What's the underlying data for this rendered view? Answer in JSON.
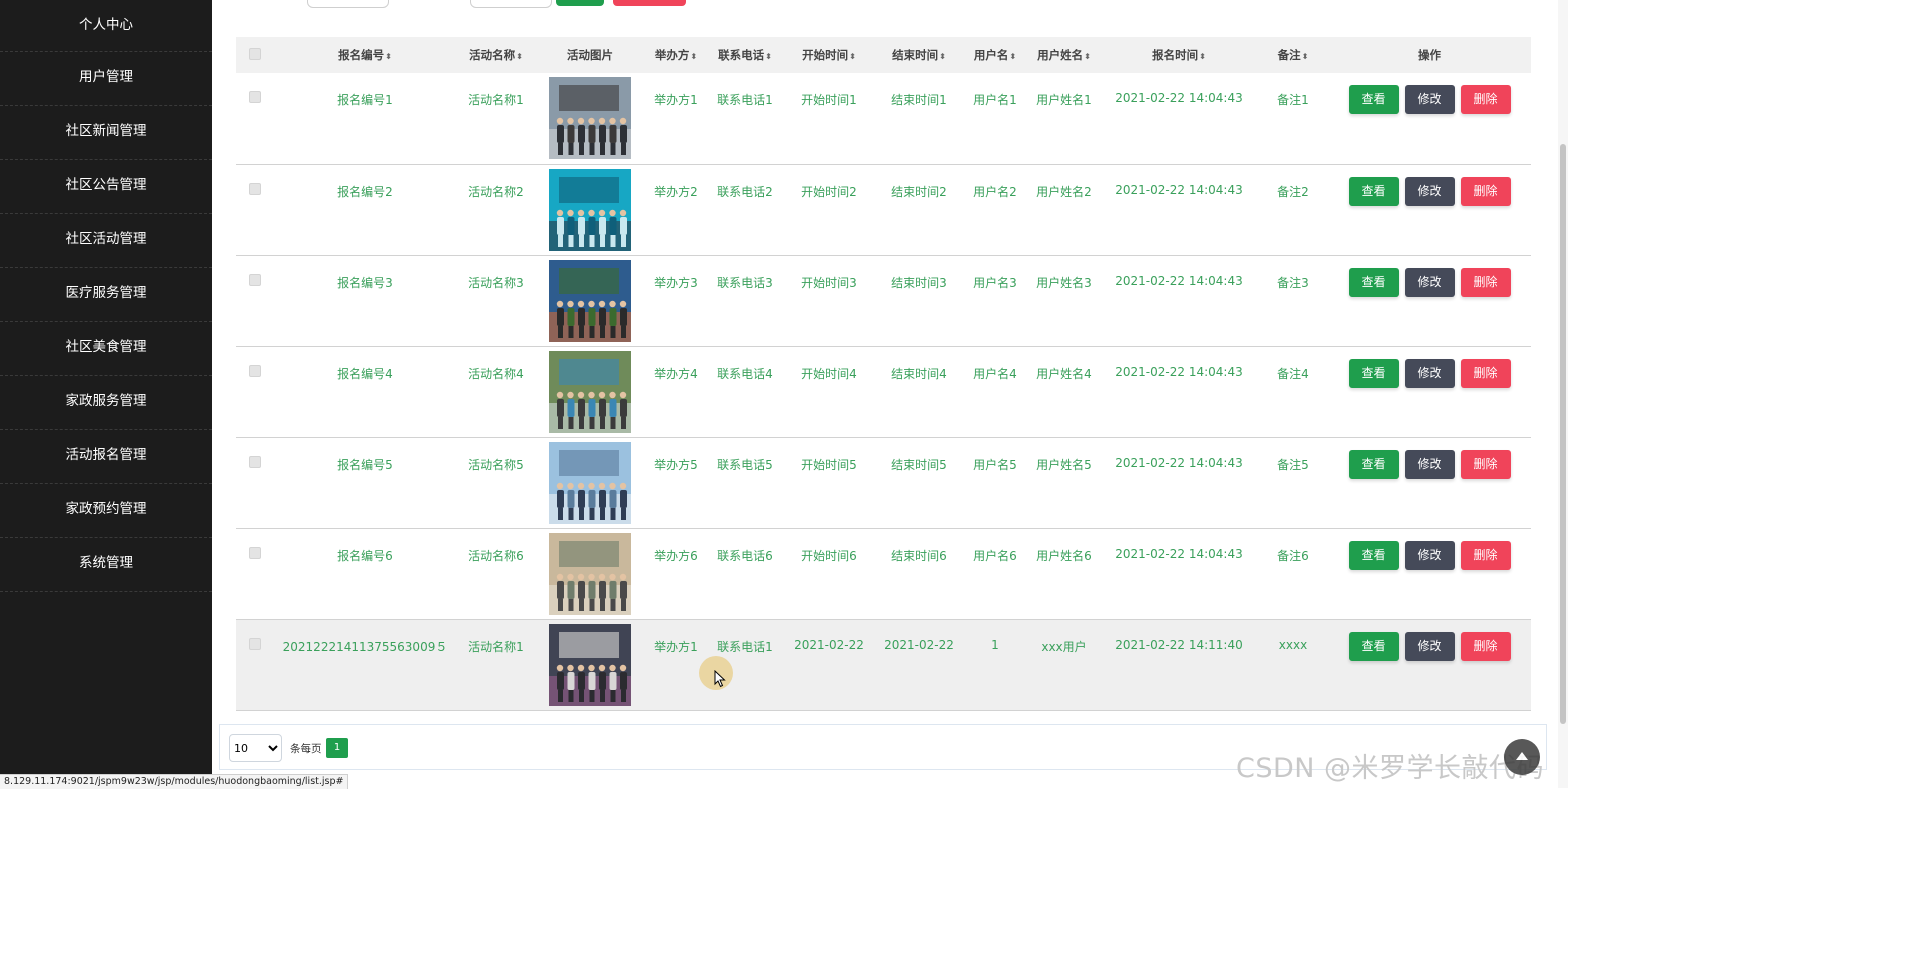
{
  "sidebar": {
    "items": [
      "个人中心",
      "用户管理",
      "社区新闻管理",
      "社区公告管理",
      "社区活动管理",
      "医疗服务管理",
      "社区美食管理",
      "家政服务管理",
      "活动报名管理",
      "家政预约管理",
      "系统管理"
    ]
  },
  "table": {
    "headers": [
      "报名编号",
      "活动名称",
      "活动图片",
      "举办方",
      "联系电话",
      "开始时间",
      "结束时间",
      "用户名",
      "用户姓名",
      "报名时间",
      "备注",
      "操作"
    ],
    "rows": [
      {
        "id": "报名编号1",
        "name": "活动名称1",
        "host": "举办方1",
        "phone": "联系电话1",
        "start": "开始时间1",
        "end": "结束时间1",
        "username": "用户名1",
        "realname": "用户姓名1",
        "time": "2021-02-22 14:04:43",
        "note": "备注1",
        "photo": "group-photo-street"
      },
      {
        "id": "报名编号2",
        "name": "活动名称2",
        "host": "举办方2",
        "phone": "联系电话2",
        "start": "开始时间2",
        "end": "结束时间2",
        "username": "用户名2",
        "realname": "用户姓名2",
        "time": "2021-02-22 14:04:43",
        "note": "备注2",
        "photo": "group-photo-stage"
      },
      {
        "id": "报名编号3",
        "name": "活动名称3",
        "host": "举办方3",
        "phone": "联系电话3",
        "start": "开始时间3",
        "end": "结束时间3",
        "username": "用户名3",
        "realname": "用户姓名3",
        "time": "2021-02-22 14:04:43",
        "note": "备注3",
        "photo": "group-photo-outdoor"
      },
      {
        "id": "报名编号4",
        "name": "活动名称4",
        "host": "举办方4",
        "phone": "联系电话4",
        "start": "开始时间4",
        "end": "结束时间4",
        "username": "用户名4",
        "realname": "用户姓名4",
        "time": "2021-02-22 14:04:43",
        "note": "备注4",
        "photo": "person-with-screen"
      },
      {
        "id": "报名编号5",
        "name": "活动名称5",
        "host": "举办方5",
        "phone": "联系电话5",
        "start": "开始时间5",
        "end": "结束时间5",
        "username": "用户名5",
        "realname": "用户姓名5",
        "time": "2021-02-22 14:04:43",
        "note": "备注5",
        "photo": "group-photo-students"
      },
      {
        "id": "报名编号6",
        "name": "活动名称6",
        "host": "举办方6",
        "phone": "联系电话6",
        "start": "开始时间6",
        "end": "结束时间6",
        "username": "用户名6",
        "realname": "用户姓名6",
        "time": "2021-02-22 14:04:43",
        "note": "备注6",
        "photo": "group-photo-indoor"
      },
      {
        "id": "20212221411375563009５",
        "name": "活动名称1",
        "host": "举办方1",
        "phone": "联系电话1",
        "start": "2021-02-22",
        "end": "2021-02-22",
        "username": "1",
        "realname": "xxx用户",
        "time": "2021-02-22 14:11:40",
        "note": "xxxx",
        "photo": "hall-crowd",
        "highlighted": true
      }
    ],
    "actions": {
      "view": "查看",
      "edit": "修改",
      "delete": "删除"
    }
  },
  "pagination": {
    "page_size": "10",
    "per_page_label": "条每页",
    "current_page": "1"
  },
  "status_url": "8.129.11.174:9021/jspm9w23w/jsp/modules/huodongbaoming/list.jsp#",
  "watermark": "CSDN @米罗学长敲代码",
  "colors": {
    "sidebar_bg": "#1c1c1c",
    "text_green": "#3aa05b",
    "view_btn": "#1f9e4d",
    "edit_btn": "#454a59",
    "delete_btn": "#f0445a"
  }
}
